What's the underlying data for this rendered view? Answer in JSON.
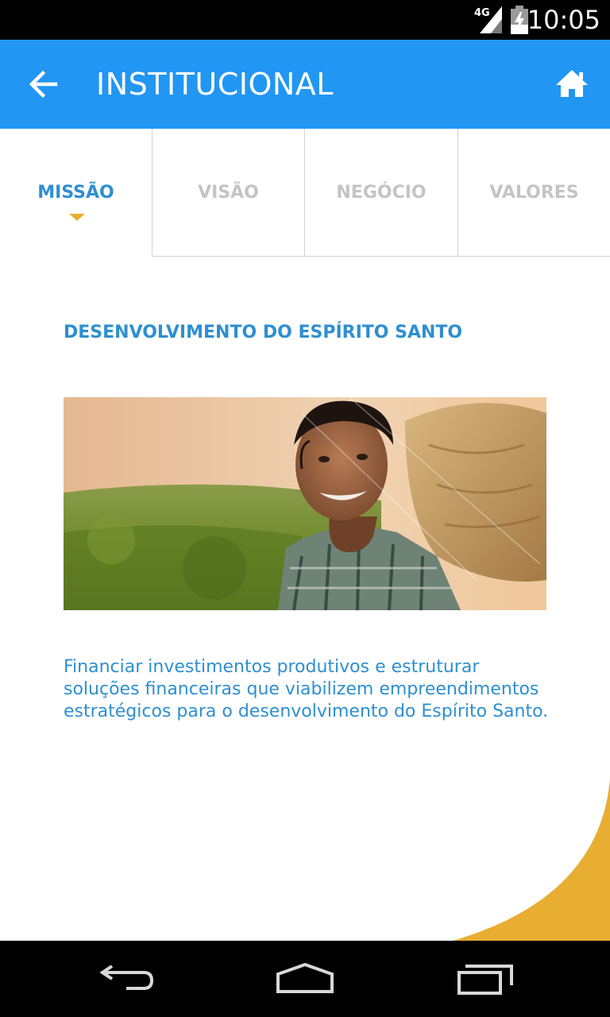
{
  "status_bar": {
    "network": "4G",
    "time": "10:05"
  },
  "app_bar": {
    "title": "INSTITUCIONAL",
    "back_icon": "arrow-left-icon",
    "home_icon": "home-icon",
    "color": "#2196f3"
  },
  "tabs": [
    {
      "label": "MISSÃO",
      "active": true
    },
    {
      "label": "VISÃO",
      "active": false
    },
    {
      "label": "NEGÓCIO",
      "active": false
    },
    {
      "label": "VALORES",
      "active": false
    }
  ],
  "content": {
    "heading": "DESENVOLVIMENTO DO ESPÍRITO SANTO",
    "body_lines": [
      "Financiar investimentos produtivos e estruturar",
      "soluções financeiras que viabilizem empreendimentos",
      "estratégicos para o desenvolvimento do Espírito Santo."
    ]
  },
  "colors": {
    "accent": "#2e8fd0",
    "highlight": "#e7ae2f",
    "inactive_tab": "#c4c4c4"
  },
  "nav_bar": {
    "icons": [
      "back-nav-icon",
      "home-nav-icon",
      "recents-nav-icon"
    ]
  }
}
